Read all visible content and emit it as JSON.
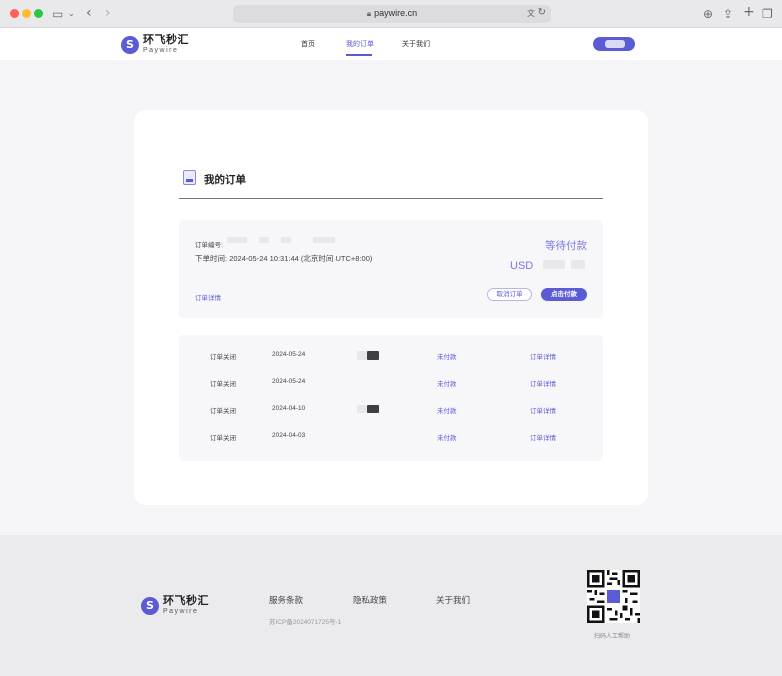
{
  "browser": {
    "url": "paywire.cn",
    "icons": [
      "sidebar-icon",
      "chevron-down-icon",
      "back-icon",
      "forward-icon",
      "lock-icon",
      "translate-icon",
      "reload-icon",
      "download-icon",
      "share-icon",
      "new-tab-icon",
      "tabs-icon"
    ]
  },
  "brand": {
    "name_cn": "环飞秒汇",
    "name_en": "Paywire",
    "accent_color": "#5b5bd6"
  },
  "nav": {
    "items": [
      {
        "label": "首页",
        "active": false
      },
      {
        "label": "我的订单",
        "active": true
      },
      {
        "label": "关于我们",
        "active": false
      }
    ]
  },
  "page": {
    "title": "我的订单"
  },
  "pending_order": {
    "order_number_label": "订单编号:",
    "time_label": "下单时间:",
    "time_value": "2024-05-24 10:31:44 (北京时间 UTC+8:00)",
    "status": "等待付款",
    "currency": "USD",
    "detail_link": "订单详情",
    "cancel_button": "取消订单",
    "pay_button": "点击付款"
  },
  "orders": [
    {
      "status": "订单关闭",
      "date": "2024-05-24",
      "payment": "未付款",
      "link": "订单详情"
    },
    {
      "status": "订单关闭",
      "date": "2024-05-24",
      "payment": "未付款",
      "link": "订单详情"
    },
    {
      "status": "订单关闭",
      "date": "2024-04-10",
      "payment": "未付款",
      "link": "订单详情"
    },
    {
      "status": "订单关闭",
      "date": "2024-04-03",
      "payment": "未付款",
      "link": "订单详情"
    }
  ],
  "footer": {
    "links": [
      "服务条款",
      "隐私政策",
      "关于我们"
    ],
    "icp": "苏ICP备2024071725号-1",
    "qr_label": "扫码人工帮助"
  }
}
